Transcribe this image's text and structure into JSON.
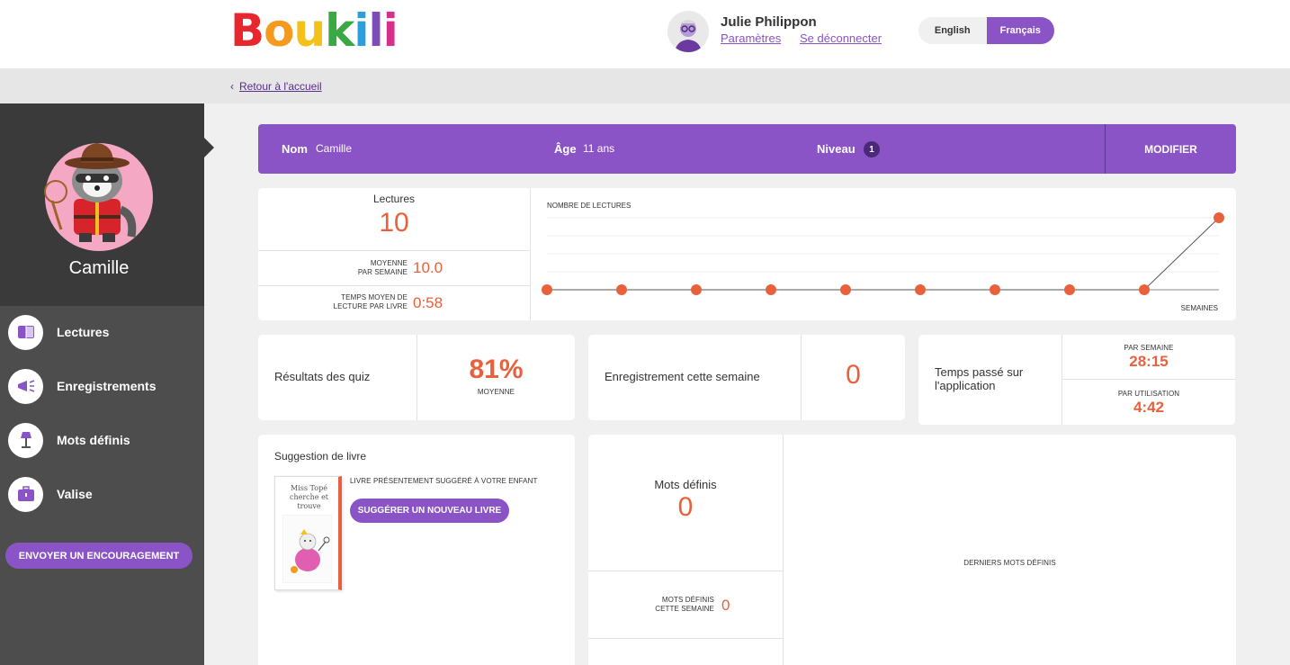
{
  "brand": {
    "letters": [
      "B",
      "o",
      "u",
      "k",
      "i",
      "l",
      "i"
    ],
    "colors": [
      "#e8262e",
      "#f39a1f",
      "#f3c11a",
      "#3aa844",
      "#2b9fd9",
      "#7a4db8",
      "#d8308a"
    ]
  },
  "user": {
    "name": "Julie Philippon",
    "settings_label": "Paramètres",
    "logout_label": "Se déconnecter"
  },
  "language": {
    "options": [
      "English",
      "Français"
    ],
    "selected": "Français"
  },
  "breadcrumb": {
    "back_label": "Retour à l'accueil"
  },
  "sidebar": {
    "child_name": "Camille",
    "items": [
      {
        "label": "Lectures",
        "icon": "book-icon"
      },
      {
        "label": "Enregistrements",
        "icon": "megaphone-icon"
      },
      {
        "label": "Mots définis",
        "icon": "lamp-icon"
      },
      {
        "label": "Valise",
        "icon": "suitcase-icon"
      }
    ],
    "encourage_label": "ENVOYER UN ENCOURAGEMENT"
  },
  "profile": {
    "name_label": "Nom",
    "name_value": "Camille",
    "age_label": "Âge",
    "age_value": "11 ans",
    "level_label": "Niveau",
    "level_value": "1",
    "modify_label": "MODIFIER"
  },
  "readings": {
    "title": "Lectures",
    "total": "10",
    "avg_label_1": "MOYENNE",
    "avg_label_2": "PAR SEMAINE",
    "avg_value": "10.0",
    "time_label_1": "TEMPS MOYEN DE",
    "time_label_2": "LECTURE PAR LIVRE",
    "time_value": "0:58"
  },
  "chart_data": {
    "type": "line",
    "title": "NOMBRE DE LECTURES",
    "xlabel": "SEMAINES",
    "ylabel": "",
    "series": [
      {
        "values": [
          0,
          0,
          0,
          0,
          0,
          0,
          0,
          0,
          0,
          10
        ]
      }
    ],
    "ylim": [
      0,
      10
    ],
    "grid": true,
    "color": "#e8613c"
  },
  "quiz": {
    "label": "Résultats des quiz",
    "value": "81%",
    "sub": "MOYENNE"
  },
  "recordings": {
    "label": "Enregistrement cette semaine",
    "value": "0"
  },
  "app_time": {
    "label": "Temps passé sur l'application",
    "week_label": "PAR SEMAINE",
    "week_value": "28:15",
    "use_label": "PAR UTILISATION",
    "use_value": "4:42"
  },
  "suggestion": {
    "title": "Suggestion de livre",
    "current_label": "LIVRE PRÉSENTEMENT SUGGÉRÉ À VOTRE ENFANT",
    "book_title": "Miss Topé cherche et trouve",
    "button_label": "SUGGÉRER UN NOUVEAU LIVRE"
  },
  "words": {
    "title": "Mots définis",
    "total": "0",
    "week_label_1": "MOTS DÉFINIS",
    "week_label_2": "CETTE SEMAINE",
    "week_value": "0",
    "latest_label": "DERNIERS MOTS DÉFINIS"
  }
}
